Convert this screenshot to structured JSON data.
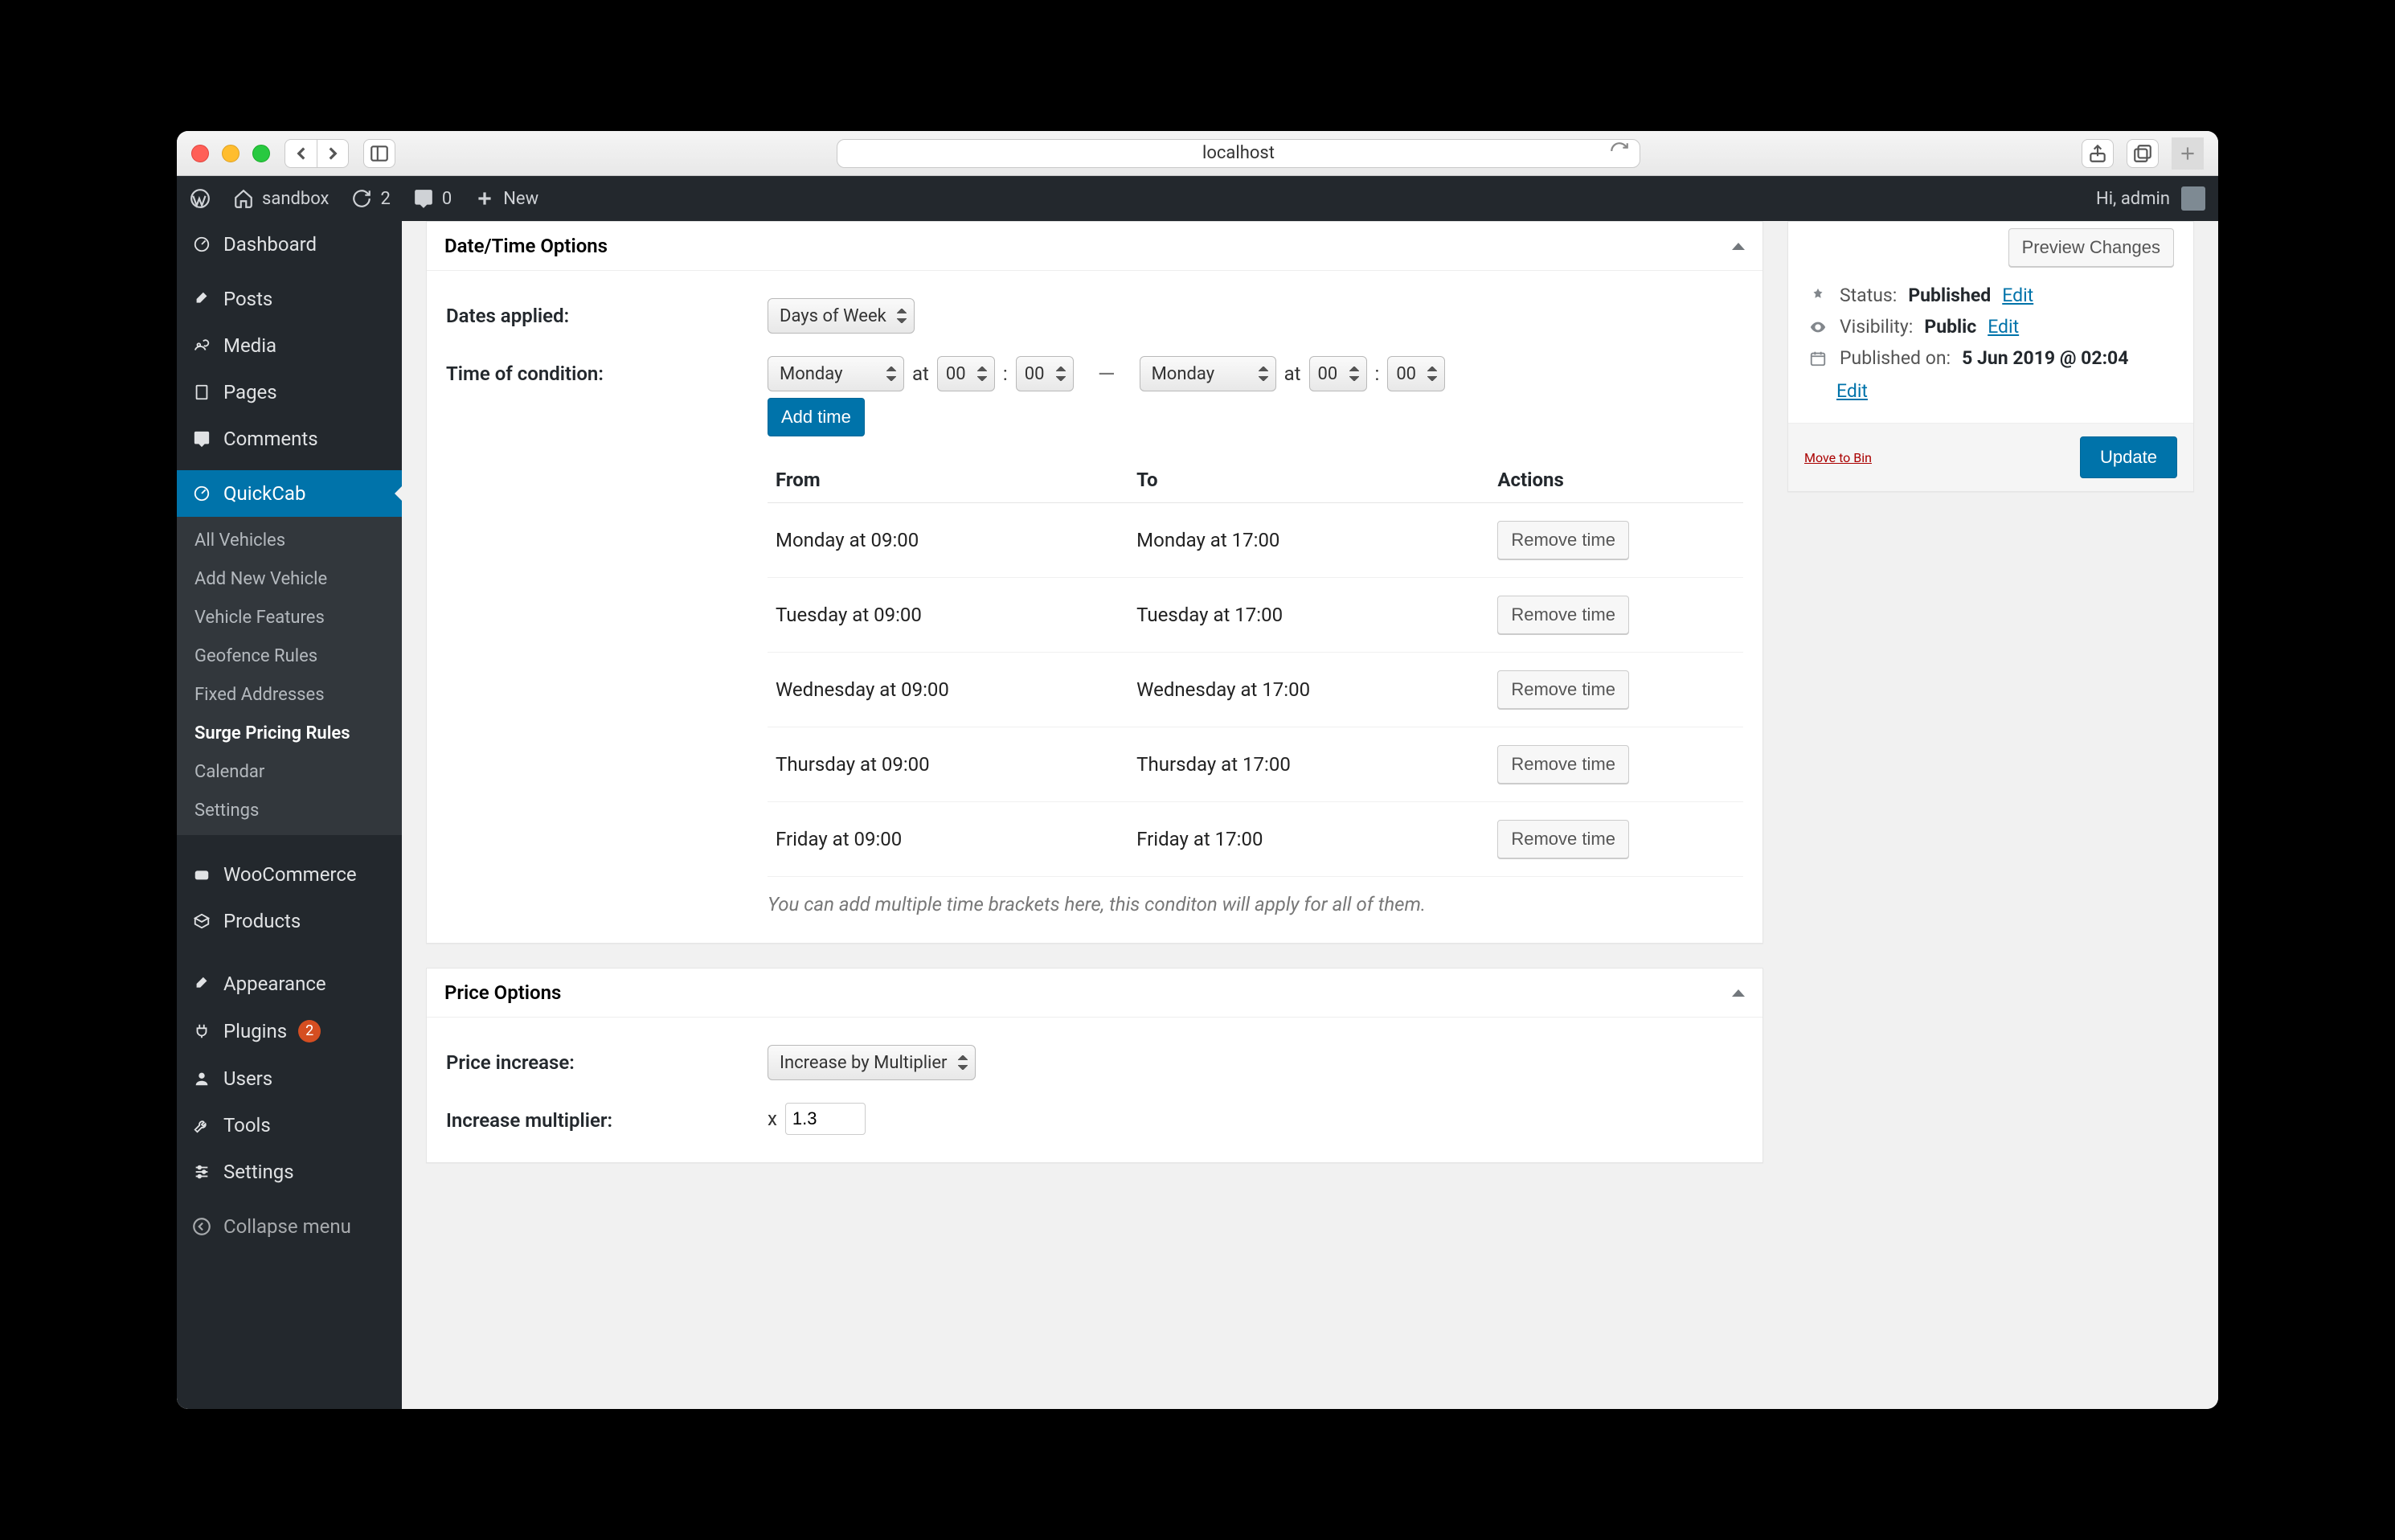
{
  "browser": {
    "url": "localhost"
  },
  "adminbar": {
    "site_name": "sandbox",
    "refresh_count": "2",
    "comments_count": "0",
    "new_label": "New",
    "greeting": "Hi, admin"
  },
  "sidebar": {
    "items": [
      {
        "label": "Dashboard"
      },
      {
        "label": "Posts"
      },
      {
        "label": "Media"
      },
      {
        "label": "Pages"
      },
      {
        "label": "Comments"
      },
      {
        "label": "QuickCab",
        "sub": [
          {
            "label": "All Vehicles"
          },
          {
            "label": "Add New Vehicle"
          },
          {
            "label": "Vehicle Features"
          },
          {
            "label": "Geofence Rules"
          },
          {
            "label": "Fixed Addresses"
          },
          {
            "label": "Surge Pricing Rules",
            "current": true
          },
          {
            "label": "Calendar"
          },
          {
            "label": "Settings"
          }
        ]
      },
      {
        "label": "WooCommerce"
      },
      {
        "label": "Products"
      },
      {
        "label": "Appearance"
      },
      {
        "label": "Plugins",
        "badge": "2"
      },
      {
        "label": "Users"
      },
      {
        "label": "Tools"
      },
      {
        "label": "Settings"
      }
    ],
    "collapse_label": "Collapse menu"
  },
  "post": {
    "datetime_heading": "Date/Time Options",
    "dates_applied_label": "Dates applied:",
    "dates_applied_value": "Days of Week",
    "time_condition_label": "Time of condition:",
    "time_condition": {
      "from_day": "Monday",
      "from_hour": "00",
      "from_min": "00",
      "to_day": "Monday",
      "to_hour": "00",
      "to_min": "00",
      "at": "at",
      "add_time_label": "Add time"
    },
    "columns": {
      "from": "From",
      "to": "To",
      "actions": "Actions"
    },
    "times": [
      {
        "from": "Monday at 09:00",
        "to": "Monday at 17:00"
      },
      {
        "from": "Tuesday at 09:00",
        "to": "Tuesday at 17:00"
      },
      {
        "from": "Wednesday at 09:00",
        "to": "Wednesday at 17:00"
      },
      {
        "from": "Thursday at 09:00",
        "to": "Thursday at 17:00"
      },
      {
        "from": "Friday at 09:00",
        "to": "Friday at 17:00"
      }
    ],
    "remove_time_label": "Remove time",
    "times_help": "You can add multiple time brackets here, this conditon will apply for all of them.",
    "price_heading": "Price Options",
    "price_increase_label": "Price increase:",
    "price_increase_value": "Increase by Multiplier",
    "multiplier_label": "Increase multiplier:",
    "multiplier_prefix": "x",
    "multiplier_value": "1.3"
  },
  "publish": {
    "preview_label": "Preview Changes",
    "status_key": "Status:",
    "status_value": "Published",
    "visibility_key": "Visibility:",
    "visibility_value": "Public",
    "published_key": "Published on:",
    "published_value": "5 Jun 2019 @ 02:04",
    "edit_label": "Edit",
    "trash_label": "Move to Bin",
    "update_label": "Update"
  }
}
